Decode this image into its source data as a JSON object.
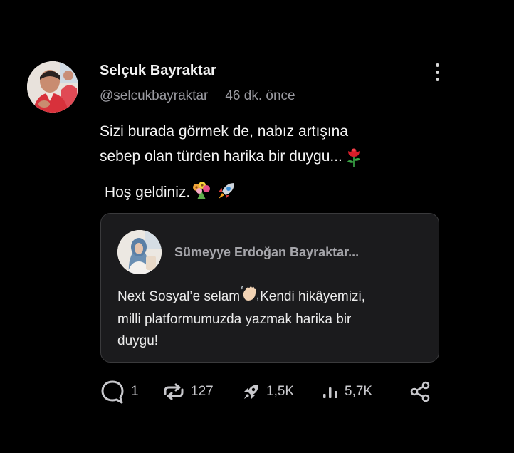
{
  "post": {
    "author_name": "Selçuk Bayraktar",
    "handle": "@selcukbayraktar",
    "time": "46 dk. önce",
    "body_lines": [
      "Sizi burada görmek de, nabız artışına",
      "sebep olan türden harika bir duygu..."
    ],
    "greeting": "Hoş geldiniz.",
    "icons": {
      "more": "more-vertical-icon",
      "rose": "rose-emoji",
      "bouquet": "bouquet-emoji",
      "rocket": "rocket-emoji"
    }
  },
  "quoted": {
    "author_name": "Sümeyye Erdoğan Bayraktar...",
    "text_line1_a": "Next Sosyal’e selam",
    "text_line1_b": "Kendi hikâyemizi,",
    "text_line2": "milli platformumuzda yazmak harika bir",
    "text_line3": "duygu!"
  },
  "actions": {
    "replies": "1",
    "reposts": "127",
    "boosts": "1,5K",
    "views": "5,7K"
  },
  "colors": {
    "background": "#000000",
    "card": "#1b1b1d",
    "muted": "#9a9aa0",
    "rose": "#d81e2a"
  }
}
